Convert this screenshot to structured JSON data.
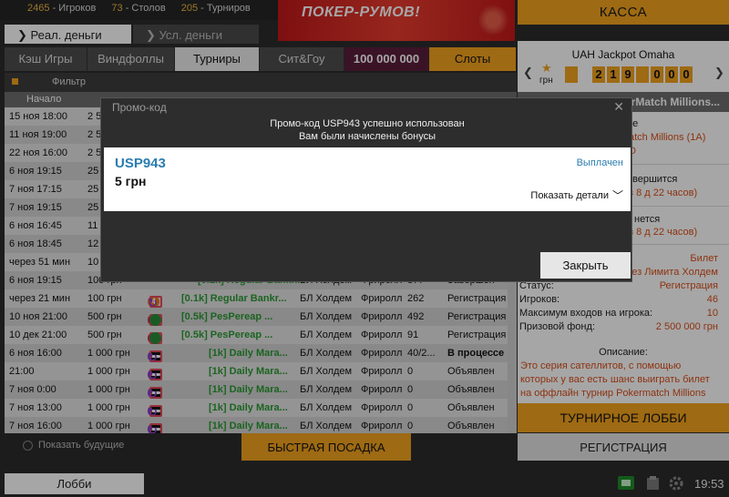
{
  "stats": {
    "players_count": "2465",
    "players_label": "- Игроков",
    "tables_count": "73",
    "tables_label": "- Столов",
    "tournaments_count": "205",
    "tournaments_label": "- Турниров"
  },
  "banner": {
    "text": "ПОКЕР-РУМОВ!"
  },
  "money_tabs": {
    "real": "❯ Реал. деньги",
    "play": "❯ Усл. деньги"
  },
  "kassa": "КАССА",
  "game_tabs": [
    "Кэш Игры",
    "Виндфоллы",
    "Турниры",
    "Сит&Гоу",
    "100 000 000",
    "Слоты"
  ],
  "filter": "Фильтр",
  "table": {
    "headers": [
      "Начало"
    ],
    "rows": [
      {
        "start": "15 ноя 18:00",
        "buyin": "2 5",
        "badge": "",
        "name": "",
        "game": "",
        "type": "",
        "players": "",
        "status": ""
      },
      {
        "start": "11 ноя 19:00",
        "buyin": "2 5",
        "badge": "",
        "name": "",
        "game": "",
        "type": "",
        "players": "",
        "status": ""
      },
      {
        "start": "22 ноя 16:00",
        "buyin": "2 5",
        "badge": "",
        "name": "",
        "game": "",
        "type": "",
        "players": "",
        "status": ""
      },
      {
        "start": "6 ноя 19:15",
        "buyin": "25",
        "badge": "",
        "name": "",
        "game": "",
        "type": "",
        "players": "",
        "status": ""
      },
      {
        "start": "7 ноя 17:15",
        "buyin": "25",
        "badge": "",
        "name": "",
        "game": "",
        "type": "",
        "players": "",
        "status": ""
      },
      {
        "start": "7 ноя 19:15",
        "buyin": "25",
        "badge": "",
        "name": "",
        "game": "",
        "type": "",
        "players": "",
        "status": ""
      },
      {
        "start": "6 ноя 16:45",
        "buyin": "11",
        "badge": "",
        "name": "",
        "game": "",
        "type": "",
        "players": "",
        "status": ""
      },
      {
        "start": "6 ноя 18:45",
        "buyin": "12",
        "badge": "",
        "name": "",
        "game": "",
        "type": "",
        "players": "",
        "status": ""
      },
      {
        "start": "через 51 мин",
        "buyin": "10",
        "badge": "",
        "name": "",
        "game": "",
        "type": "",
        "players": "",
        "status": ""
      },
      {
        "start": "6 ноя 19:15",
        "buyin": "100 грн",
        "badge": "",
        "name": "[0.1k] Regular Bankr...",
        "game": "БЛ Холдем",
        "type": "Фриролл",
        "players": "377",
        "status": "Завершен"
      },
      {
        "start": "через 21 мин",
        "buyin": "100 грн",
        "badge": "4",
        "name": "[0.1k] Regular Bankr...",
        "game": "БЛ Холдем",
        "type": "Фриролл",
        "players": "262",
        "status": "Регистрация"
      },
      {
        "start": "10 ноя 21:00",
        "buyin": "500 грн",
        "badge": "9",
        "name": "[0.5k] PesPereap ...",
        "game": "БЛ Холдем",
        "type": "Фриролл",
        "players": "492",
        "status": "Регистрация"
      },
      {
        "start": "10 дек 21:00",
        "buyin": "500 грн",
        "badge": "9",
        "name": "[0.5k] PesPereap ...",
        "game": "БЛ Холдем",
        "type": "Фриролл",
        "players": "91",
        "status": "Регистрация"
      },
      {
        "start": "6 ноя 16:00",
        "buyin": "1 000 грн",
        "badge": "6",
        "name": "[1k] Daily Mara...",
        "game": "БЛ Холдем",
        "type": "Фриролл",
        "players": "40/2...",
        "status": "В процессе"
      },
      {
        "start": "21:00",
        "buyin": "1 000 грн",
        "badge": "6",
        "name": "[1k] Daily Mara...",
        "game": "БЛ Холдем",
        "type": "Фриролл",
        "players": "0",
        "status": "Объявлен"
      },
      {
        "start": "7 ноя 0:00",
        "buyin": "1 000 грн",
        "badge": "6",
        "name": "[1k] Daily Mara...",
        "game": "БЛ Холдем",
        "type": "Фриролл",
        "players": "0",
        "status": "Объявлен"
      },
      {
        "start": "7 ноя 13:00",
        "buyin": "1 000 грн",
        "badge": "6",
        "name": "[1k] Daily Mara...",
        "game": "БЛ Холдем",
        "type": "Фриролл",
        "players": "0",
        "status": "Объявлен"
      },
      {
        "start": "7 ноя 16:00",
        "buyin": "1 000 грн",
        "badge": "6",
        "name": "[1k] Daily Mara...",
        "game": "БЛ Холдем",
        "type": "Фриролл",
        "players": "0",
        "status": "Объявлен"
      }
    ]
  },
  "show_future": "Показать будущие",
  "fast_seat": "БЫСТРАЯ ПОСАДКА",
  "lobby": "Лобби",
  "time": "19:53",
  "jackpot": {
    "title": "UAH Jackpot Omaha",
    "currency": "грн",
    "digits": [
      "",
      "2",
      "1",
      "9",
      "",
      "0",
      "0",
      "0"
    ]
  },
  "right": {
    "title_fragment": "erMatch Millions...",
    "l1": "ие",
    "l2": "atch Millions (1A)",
    "l3": "D",
    "l4": "вершится",
    "l5": "з 8 д 22 часов)",
    "l6": "нется",
    "l7": "з 8 д 22 часов)",
    "kv": [
      {
        "k": "",
        "v": "Билет"
      },
      {
        "k": "",
        "v": "ез Лимита Холдем"
      },
      {
        "k": "Статус:",
        "v": "Регистрация"
      },
      {
        "k": "Игроков:",
        "v": "46"
      },
      {
        "k": "Максимум входов на игрока:",
        "v": "10"
      },
      {
        "k": "Призовой фонд:",
        "v": "2 500 000 грн"
      }
    ],
    "desc_title": "Описание:",
    "desc": "Это серия сателлитов, с помощью которых у вас есть шанс выиграть билет на оффлайн турнир Pokermatch Millions"
  },
  "tournament_lobby": "ТУРНИРНОЕ ЛОББИ",
  "register": "РЕГИСТРАЦИЯ",
  "modal": {
    "title": "Промо-код",
    "close": "✕",
    "message1": "Промо-код USP943 успешно использован",
    "message2": "Вам были начислены бонусы",
    "code": "USP943",
    "amount": "5 грн",
    "status": "Выплачен",
    "details": "Показать детали",
    "close_button": "Закрыть"
  },
  "colors": {
    "accent": "#f3a41e",
    "tournament_name": "#2a9a33",
    "link": "#2b7db0",
    "value": "#d94f1a"
  }
}
